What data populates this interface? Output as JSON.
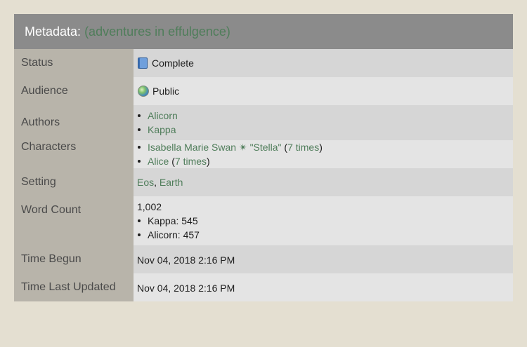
{
  "header": {
    "label": "Metadata:",
    "title": "(adventures in effulgence)"
  },
  "status": {
    "key": "Status",
    "icon": "book-icon",
    "value": "Complete"
  },
  "audience": {
    "key": "Audience",
    "icon": "globe-icon",
    "value": "Public"
  },
  "authors": {
    "key": "Authors",
    "items": [
      "Alicorn",
      "Kappa"
    ]
  },
  "characters": {
    "key": "Characters",
    "items": [
      {
        "name": "Isabella Marie Swan ✴ \"Stella\"",
        "times": "7 times"
      },
      {
        "name": "Alice",
        "times": "7 times"
      }
    ]
  },
  "setting": {
    "key": "Setting",
    "items": [
      "Eos",
      "Earth"
    ],
    "separator": ", "
  },
  "word_count": {
    "key": "Word Count",
    "total": "1,002",
    "items": [
      "Kappa: 545",
      "Alicorn: 457"
    ]
  },
  "time_begun": {
    "key": "Time Begun",
    "value": "Nov 04, 2018 2:16 PM"
  },
  "time_updated": {
    "key": "Time Last Updated",
    "value": "Nov 04, 2018 2:16 PM"
  },
  "colors": {
    "page_bg": "#e4dfd1",
    "header_bg": "#8b8b8b",
    "key_bg": "#b8b4aa",
    "link": "#4f7d5a"
  }
}
